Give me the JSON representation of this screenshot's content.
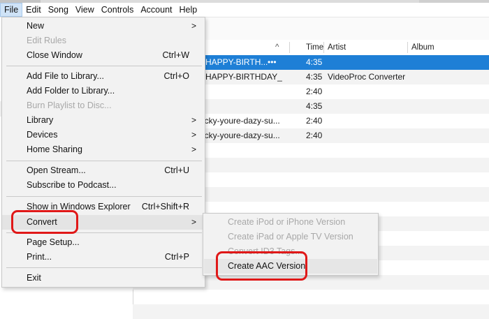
{
  "menubar": {
    "items": [
      {
        "label": "File"
      },
      {
        "label": "Edit"
      },
      {
        "label": "Song"
      },
      {
        "label": "View"
      },
      {
        "label": "Controls"
      },
      {
        "label": "Account"
      },
      {
        "label": "Help"
      }
    ]
  },
  "table": {
    "columns": {
      "time": "Time",
      "artist": "Artist",
      "album": "Album"
    },
    "sort_indicator": "^",
    "rows": [
      {
        "name": "-HAPPY-BIRTH...",
        "dots": "•••",
        "time": "4:35",
        "artist": ""
      },
      {
        "name": "-HAPPY-BIRTHDAY_",
        "dots": "",
        "time": "4:35",
        "artist": "VideoProc Converter"
      },
      {
        "name": "",
        "dots": "",
        "time": "2:40",
        "artist": ""
      },
      {
        "name": "",
        "dots": "",
        "time": "4:35",
        "artist": ""
      },
      {
        "name": "icky-youre-dazy-su...",
        "dots": "",
        "time": "2:40",
        "artist": ""
      },
      {
        "name": "icky-youre-dazy-su...",
        "dots": "",
        "time": "2:40",
        "artist": ""
      }
    ]
  },
  "file_menu": {
    "new": {
      "label": "New",
      "arrow": ">"
    },
    "edit_rules": {
      "label": "Edit Rules"
    },
    "close_window": {
      "label": "Close Window",
      "shortcut": "Ctrl+W"
    },
    "add_file": {
      "label": "Add File to Library...",
      "shortcut": "Ctrl+O"
    },
    "add_folder": {
      "label": "Add Folder to Library..."
    },
    "burn_playlist": {
      "label": "Burn Playlist to Disc..."
    },
    "library": {
      "label": "Library",
      "arrow": ">"
    },
    "devices": {
      "label": "Devices",
      "arrow": ">"
    },
    "home_sharing": {
      "label": "Home Sharing",
      "arrow": ">"
    },
    "open_stream": {
      "label": "Open Stream...",
      "shortcut": "Ctrl+U"
    },
    "subscribe_podcast": {
      "label": "Subscribe to Podcast..."
    },
    "show_explorer": {
      "label": "Show in Windows Explorer",
      "shortcut": "Ctrl+Shift+R"
    },
    "convert": {
      "label": "Convert",
      "arrow": ">"
    },
    "page_setup": {
      "label": "Page Setup..."
    },
    "print": {
      "label": "Print...",
      "shortcut": "Ctrl+P"
    },
    "exit": {
      "label": "Exit"
    }
  },
  "convert_submenu": {
    "ipod_iphone": {
      "label": "Create iPod or iPhone Version"
    },
    "ipad_appletv": {
      "label": "Create iPad or Apple TV Version"
    },
    "id3_tags": {
      "label": "Convert ID3 Tags..."
    },
    "aac": {
      "label": "Create AAC Version"
    }
  },
  "colors": {
    "selection": "#1e7fd6",
    "annotation": "#e01818",
    "menu_background": "#f2f2f2",
    "disabled_text": "#a8a8a8"
  }
}
